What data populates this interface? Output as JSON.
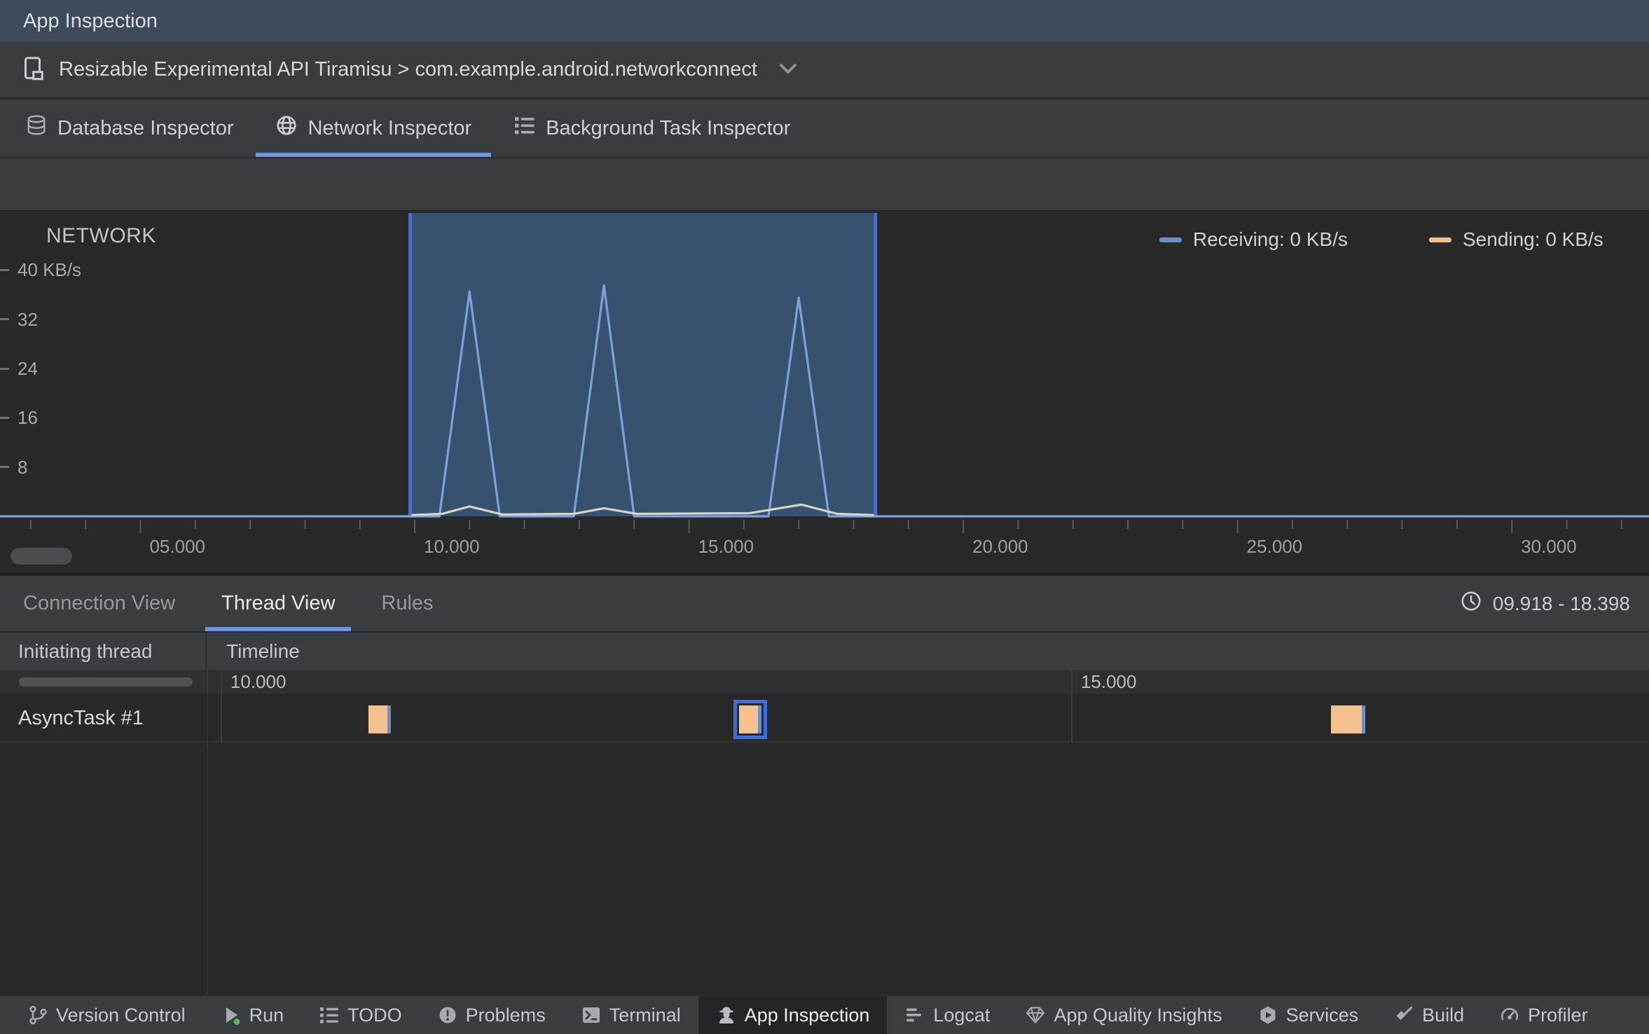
{
  "title_bar": {
    "title": "App Inspection"
  },
  "device_bar": {
    "selector": "Resizable Experimental API Tiramisu > com.example.android.networkconnect"
  },
  "inspector_tabs": [
    {
      "label": "Database Inspector",
      "active": false
    },
    {
      "label": "Network Inspector",
      "active": true
    },
    {
      "label": "Background Task Inspector",
      "active": false
    }
  ],
  "chart_data": {
    "type": "area",
    "title": "NETWORK",
    "x_unit": "seconds",
    "y_unit": "KB/s",
    "x_range": [
      2.44,
      32.5
    ],
    "y_range": [
      0,
      49.5
    ],
    "grid": false,
    "legend_position": "top-right",
    "x_ticks": [
      {
        "value": 5,
        "label": "05.000"
      },
      {
        "value": 10,
        "label": "10.000"
      },
      {
        "value": 15,
        "label": "15.000"
      },
      {
        "value": 20,
        "label": "20.000"
      },
      {
        "value": 25,
        "label": "25.000"
      },
      {
        "value": 30,
        "label": "30.000"
      }
    ],
    "x_minor_tick_interval": 1,
    "y_ticks": [
      {
        "value": 40,
        "label": "40 KB/s"
      },
      {
        "value": 32,
        "label": "32"
      },
      {
        "value": 24,
        "label": "24"
      },
      {
        "value": 16,
        "label": "16"
      },
      {
        "value": 8,
        "label": "8"
      }
    ],
    "selection": {
      "start": 9.918,
      "end": 18.398,
      "fill": "#36526F",
      "border": "#3E6FDC"
    },
    "series": [
      {
        "name": "Receiving",
        "legend_label": "Receiving: 0 KB/s",
        "current_value": "0 KB/s",
        "color": "#7DA1DA",
        "legend_color": "#6C8FC7",
        "points": [
          [
            2.44,
            0
          ],
          [
            10.45,
            0
          ],
          [
            11.0,
            36.5
          ],
          [
            11.55,
            0
          ],
          [
            12.9,
            0
          ],
          [
            13.45,
            37.5
          ],
          [
            14.0,
            0
          ],
          [
            16.45,
            0
          ],
          [
            17.0,
            35.5
          ],
          [
            17.55,
            0
          ],
          [
            32.5,
            0
          ]
        ]
      },
      {
        "name": "Sending",
        "legend_label": "Sending: 0 KB/s",
        "current_value": "0 KB/s",
        "color": "#D9D3C2",
        "legend_color": "#F2C189",
        "points": [
          [
            9.94,
            0.2
          ],
          [
            10.5,
            0.4
          ],
          [
            11.0,
            1.6
          ],
          [
            11.6,
            0.3
          ],
          [
            12.9,
            0.4
          ],
          [
            13.45,
            1.3
          ],
          [
            14.05,
            0.4
          ],
          [
            16.1,
            0.5
          ],
          [
            17.05,
            1.9
          ],
          [
            17.7,
            0.4
          ],
          [
            18.37,
            0.2
          ]
        ]
      }
    ]
  },
  "bottom_panel": {
    "tabs": [
      {
        "label": "Connection View",
        "active": false
      },
      {
        "label": "Thread View",
        "active": true
      },
      {
        "label": "Rules",
        "active": false
      }
    ],
    "selected_range": "09.918 - 18.398",
    "range": {
      "start": 9.918,
      "end": 18.398
    },
    "table": {
      "columns": [
        "Initiating thread",
        "Timeline"
      ],
      "timeline_ticks": [
        {
          "value": 10,
          "label": "10.000"
        },
        {
          "value": 15,
          "label": "15.000"
        }
      ],
      "rows": [
        {
          "thread": "AsyncTask #1",
          "blocks": [
            {
              "start": 10.87,
              "send_end": 10.98,
              "end": 11.0,
              "selected": false
            },
            {
              "start": 13.05,
              "send_end": 13.16,
              "end": 13.18,
              "selected": true
            },
            {
              "start": 16.53,
              "send_end": 16.71,
              "end": 16.73,
              "selected": false
            }
          ]
        }
      ]
    },
    "block_colors": {
      "send": "#F4C28E",
      "receive": "#6C8FC9",
      "selection": "#3E6FDC"
    }
  },
  "status_bar": {
    "items": [
      {
        "label": "Version Control",
        "icon": "git-branch-icon",
        "active": false
      },
      {
        "label": "Run",
        "icon": "run-icon",
        "active": false
      },
      {
        "label": "TODO",
        "icon": "todo-icon",
        "active": false
      },
      {
        "label": "Problems",
        "icon": "problems-icon",
        "active": false
      },
      {
        "label": "Terminal",
        "icon": "terminal-icon",
        "active": false
      },
      {
        "label": "App Inspection",
        "icon": "spy-icon",
        "active": true
      },
      {
        "label": "Logcat",
        "icon": "logcat-icon",
        "active": false
      },
      {
        "label": "App Quality Insights",
        "icon": "gem-icon",
        "active": false
      },
      {
        "label": "Services",
        "icon": "services-icon",
        "active": false
      },
      {
        "label": "Build",
        "icon": "build-icon",
        "active": false
      },
      {
        "label": "Profiler",
        "icon": "profiler-icon",
        "active": false
      }
    ]
  },
  "colors": {
    "titlebar_bg": "#3D4B5D",
    "panel_bg": "#3A3D3F",
    "chart_bg": "#29292A",
    "accent_underline": "#6E96E8",
    "selection_fill": "#36526F",
    "selection_border": "#3E6FDC",
    "receiving": "#7DA1DA",
    "sending_legend": "#F2C189",
    "block_orange": "#F4C28E",
    "block_blue": "#6C8FC9"
  }
}
